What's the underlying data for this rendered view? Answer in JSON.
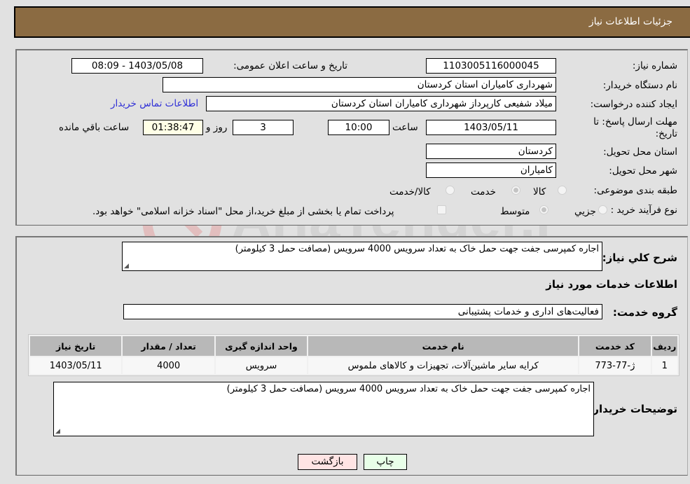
{
  "header": {
    "title": "جزئیات اطلاعات نیاز"
  },
  "info": {
    "need_number_label": "شماره نیاز:",
    "need_number": "1103005116000045",
    "announce_label": "تاریخ و ساعت اعلان عمومی:",
    "announce_value": "1403/05/08 - 08:09",
    "buyer_org_label": "نام دستگاه خریدار:",
    "buyer_org": "شهرداری کامیاران استان کردستان",
    "creator_label": "ایجاد کننده درخواست:",
    "creator": "میلاد شفیعی کارپرداز شهرداری کامیاران استان کردستان",
    "contact_link": "اطلاعات تماس خریدار",
    "deadline_label": "مهلت ارسال پاسخ: تا تاریخ:",
    "deadline_date": "1403/05/11",
    "time_label": "ساعت",
    "deadline_time": "10:00",
    "days_value": "3",
    "days_label": "روز و",
    "remaining_time": "01:38:47",
    "remaining_label": "ساعت باقي مانده",
    "province_label": "استان محل تحویل:",
    "province": "کردستان",
    "city_label": "شهر محل تحویل:",
    "city": "کامیاران",
    "category_label": "طبقه بندی موضوعی:",
    "category_options": [
      {
        "label": "کالا",
        "checked": false
      },
      {
        "label": "خدمت",
        "checked": true
      },
      {
        "label": "کالا/خدمت",
        "checked": false
      }
    ],
    "process_label": "نوع فرآیند خرید :",
    "process_options": [
      {
        "label": "جزيي",
        "checked": false
      },
      {
        "label": "متوسط",
        "checked": true
      }
    ],
    "treasury_note": "پرداخت تمام یا بخشی از مبلغ خرید،از محل \"اسناد خزانه اسلامی\" خواهد بود."
  },
  "details": {
    "summary_label": "شرح کلي نیاز:",
    "summary": "اجاره کمپرسی جفت جهت حمل خاک به تعداد  سرویس 4000 سرویس (مصافت حمل 3 کیلومتر)",
    "services_heading": "اطلاعات خدمات مورد نیاز",
    "service_group_label": "گروه خدمت:",
    "service_group": "فعالیت‌های اداری و خدمات پشتیبانی",
    "table": {
      "headers": [
        "ردیف",
        "کد خدمت",
        "نام خدمت",
        "واحد اندازه گیری",
        "تعداد / مقدار",
        "تاریخ نیاز"
      ],
      "rows": [
        [
          "1",
          "ژ-77-773",
          "کرایه سایر ماشین‌آلات، تجهیزات و کالاهای ملموس",
          "سرویس",
          "4000",
          "1403/05/11"
        ]
      ]
    },
    "buyer_notes_label": "توضیحات خریدار:",
    "buyer_notes": "اجاره کمپرسی جفت جهت حمل خاک به تعداد  سرویس 4000 سرویس (مصافت حمل 3 کیلومتر)"
  },
  "buttons": {
    "print": "چاپ",
    "back": "بازگشت"
  },
  "watermark": {
    "text": "AriaTender.neT"
  }
}
